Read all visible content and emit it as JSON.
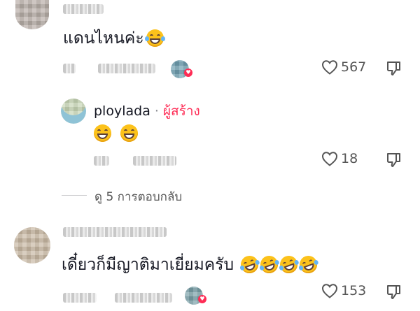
{
  "comments": [
    {
      "text": "แดนไหนค่ะ",
      "emoji_icons": [
        "laugh-tears-emoji-icon"
      ],
      "likes": "567",
      "liked_by_creator": true
    },
    {
      "author": "ploylada",
      "separator": "·",
      "creator_label": "ผู้สร้าง",
      "emoji_icons": [
        "grin-emoji-icon",
        "grin-emoji-icon"
      ],
      "likes": "18"
    },
    {
      "text": "เดี๋ยวก็มีญาติมาเยี่ยมครับ",
      "emoji_icons": [
        "rofl-emoji-icon",
        "rofl-emoji-icon",
        "rofl-emoji-icon",
        "rofl-emoji-icon"
      ],
      "likes": "153",
      "liked_by_creator": true
    }
  ],
  "view_replies": "ดู 5 การตอบกลับ",
  "colors": {
    "text": "#161823",
    "muted": "#555555",
    "accent": "#fe2c55"
  },
  "icons": {
    "like": "heart-outline-icon",
    "dislike": "thumb-down-outline-icon",
    "creator_like": "heart-badge-icon"
  }
}
